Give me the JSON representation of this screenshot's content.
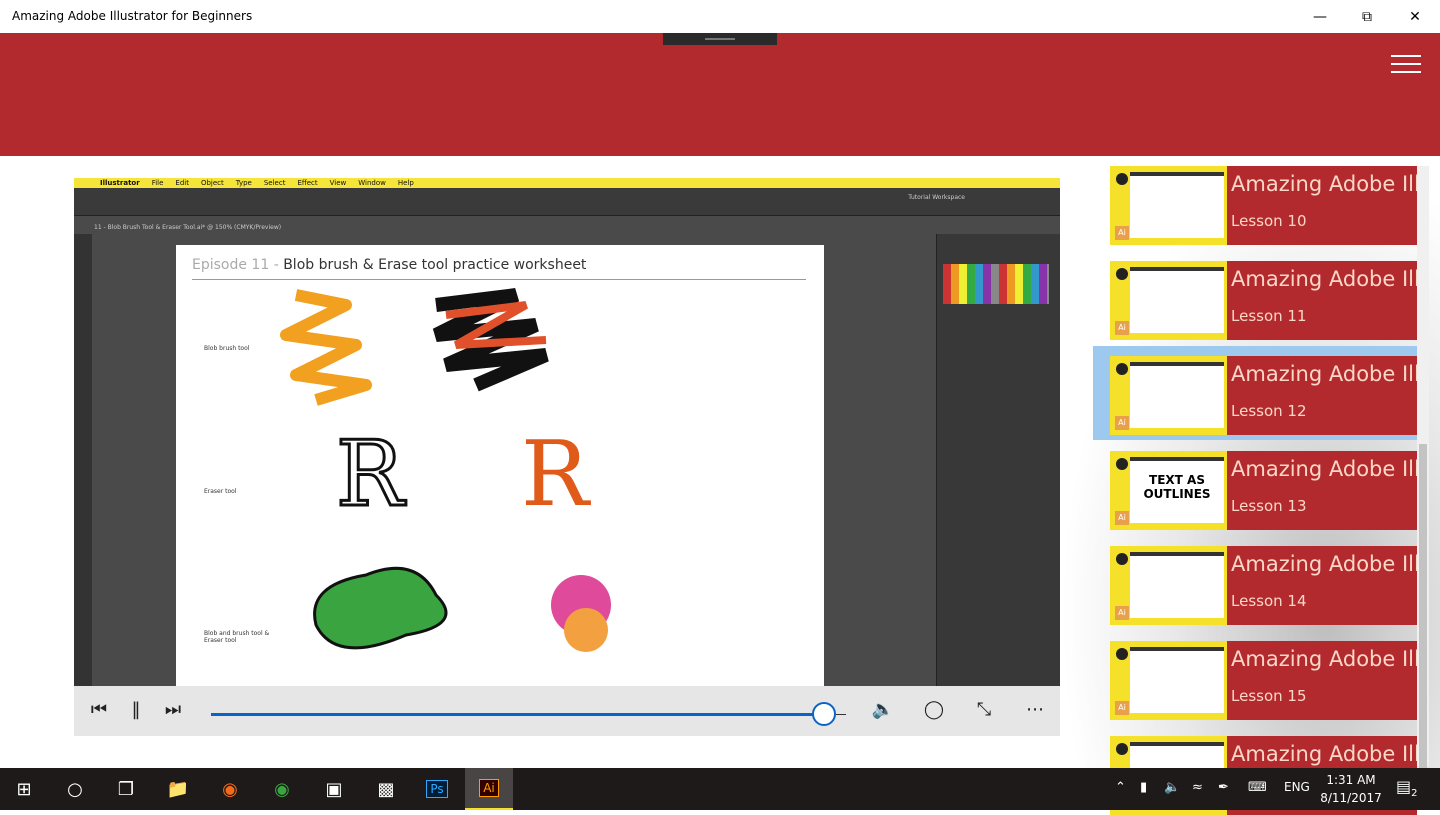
{
  "window": {
    "title": "Amazing Adobe Illustrator for Beginners",
    "minimize_icon": "minimize-icon",
    "maximize_icon": "restore-icon",
    "close_icon": "close-icon"
  },
  "header": {
    "menu_icon": "hamburger-icon",
    "color": "#b22a2e"
  },
  "video": {
    "menu": [
      "Illustrator",
      "File",
      "Edit",
      "Object",
      "Type",
      "Select",
      "Effect",
      "View",
      "Window",
      "Help"
    ],
    "doc_tab": "11 - Blob Brush Tool & Eraser Tool.ai* @ 150% (CMYK/Preview)",
    "worksheet_episode": "Episode 11 -",
    "worksheet_title": "Blob brush & Erase tool practice worksheet",
    "row_labels": [
      "Blob brush tool",
      "Eraser tool",
      "Blob and brush tool & Eraser tool"
    ],
    "workspace": "Tutorial Workspace"
  },
  "player": {
    "progress": 0.96,
    "buttons": [
      "previous",
      "pause",
      "next",
      "volume",
      "cast",
      "fullscreen",
      "more"
    ]
  },
  "lessons": [
    {
      "title": "Amazing Adobe Illustrator for Beginners",
      "lesson": "Lesson 10"
    },
    {
      "title": "Amazing Adobe Illustrator for Beginners",
      "lesson": "Lesson 11"
    },
    {
      "title": "Amazing Adobe Illustrator for Beginners",
      "lesson": "Lesson 12",
      "selected": true
    },
    {
      "title": "Amazing Adobe Illustrator for Beginners",
      "lesson": "Lesson 13",
      "thumb_text": "TEXT AS OUTLINES"
    },
    {
      "title": "Amazing Adobe Illustrator for Beginners",
      "lesson": "Lesson 14"
    },
    {
      "title": "Amazing Adobe Illustrator for Beginners",
      "lesson": "Lesson 15"
    },
    {
      "title": "Amazing Adobe Illustrator for Beginners",
      "lesson": ""
    }
  ],
  "badge": "Ai",
  "taskbar": {
    "language": "ENG",
    "time": "1:31 AM",
    "date": "8/11/2017",
    "notifications": "2",
    "active_app": "Ai",
    "ps_label": "Ps"
  }
}
